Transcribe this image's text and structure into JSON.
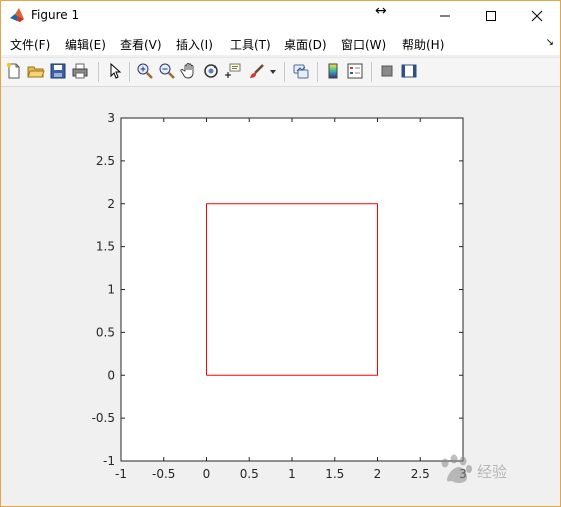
{
  "window": {
    "title": "Figure 1",
    "resize_glyph": "↔",
    "accent_border": "#e3a54a"
  },
  "menu": {
    "items": [
      {
        "label": "文件(F)"
      },
      {
        "label": "编辑(E)"
      },
      {
        "label": "查看(V)"
      },
      {
        "label": "插入(I)"
      },
      {
        "label": "工具(T)"
      },
      {
        "label": "桌面(D)"
      },
      {
        "label": "窗口(W)"
      },
      {
        "label": "帮助(H)"
      }
    ],
    "overflow_glyph": "↘"
  },
  "toolbar": {
    "icons": [
      "new-figure-icon",
      "open-file-icon",
      "save-icon",
      "print-icon",
      "pointer-icon",
      "zoom-in-icon",
      "zoom-out-icon",
      "pan-icon",
      "rotate-3d-icon",
      "data-cursor-icon",
      "brush-icon",
      "brush-dropdown-icon",
      "link-plot-icon",
      "insert-colorbar-icon",
      "insert-legend-icon",
      "hide-plot-tools-icon",
      "show-plot-tools-icon"
    ]
  },
  "chart_data": {
    "type": "line",
    "title": "",
    "xlabel": "",
    "ylabel": "",
    "xlim": [
      -1,
      3
    ],
    "ylim": [
      -1,
      3
    ],
    "x_ticks": [
      "-1",
      "-0.5",
      "0",
      "0.5",
      "1",
      "1.5",
      "2",
      "2.5",
      "3"
    ],
    "y_ticks": [
      "-1",
      "-0.5",
      "0",
      "0.5",
      "1",
      "1.5",
      "2",
      "2.5",
      "3"
    ],
    "grid": false,
    "series": [
      {
        "color": "#ff0000",
        "x": [
          0,
          2,
          2,
          0,
          0
        ],
        "y": [
          0,
          0,
          2,
          2,
          0
        ]
      }
    ]
  },
  "watermark": {
    "text": "经验"
  }
}
